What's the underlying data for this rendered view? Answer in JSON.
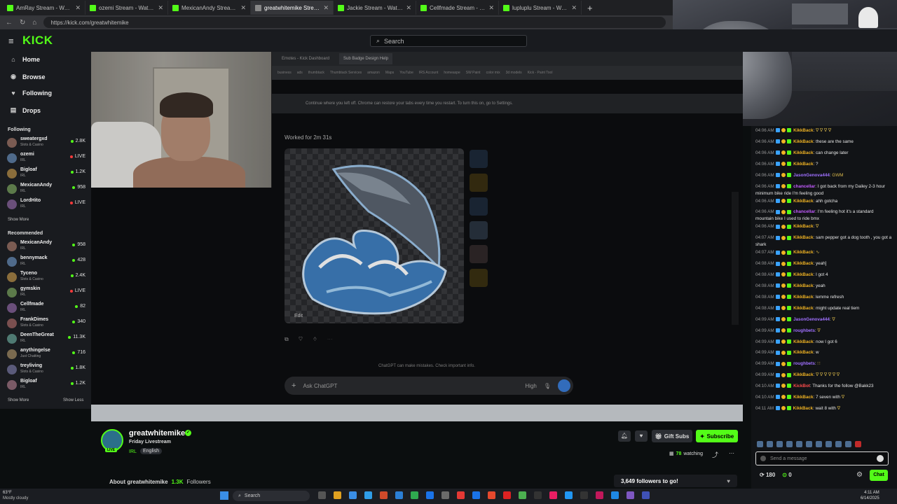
{
  "browser": {
    "tabs": [
      {
        "label": "AmRay Stream - Watch Live o",
        "active": false
      },
      {
        "label": "ozemi Stream - Watch Live on",
        "active": false
      },
      {
        "label": "MexicanAndy Stream - Watch",
        "active": false
      },
      {
        "label": "greatwhitemike Stream - Wat",
        "active": true
      },
      {
        "label": "Jackie Stream - Watch Live on Kick",
        "active": false
      },
      {
        "label": "Cellfmade Stream - Watch Live on",
        "active": false
      },
      {
        "label": "lupluplu Stream - Watch Live on K",
        "active": false
      }
    ],
    "url": "https://kick.com/greatwhitemike"
  },
  "header": {
    "logo": "KICK",
    "search_placeholder": "Search"
  },
  "sidebar": {
    "nav": [
      {
        "label": "Home",
        "icon": "home-icon",
        "glyph": "⌂"
      },
      {
        "label": "Browse",
        "icon": "compass-icon",
        "glyph": "◉"
      },
      {
        "label": "Following",
        "icon": "heart-icon",
        "glyph": "♥"
      },
      {
        "label": "Drops",
        "icon": "drops-icon",
        "glyph": "▤"
      }
    ],
    "following_heading": "Following",
    "following": [
      {
        "name": "sweatergxd",
        "category": "Slots & Casino",
        "viewers": "2.8K"
      },
      {
        "name": "ozemi",
        "category": "IRL",
        "viewers": "LIVE"
      },
      {
        "name": "Bigloaf",
        "category": "IRL",
        "viewers": "1.2K"
      },
      {
        "name": "MexicanAndy",
        "category": "IRL",
        "viewers": "958"
      },
      {
        "name": "LordHito",
        "category": "IRL",
        "viewers": "LIVE"
      }
    ],
    "following_show_more": "Show More",
    "recommended_heading": "Recommended",
    "recommended": [
      {
        "name": "MexicanAndy",
        "category": "IRL",
        "viewers": "958"
      },
      {
        "name": "bennymack",
        "category": "IRL",
        "viewers": "428"
      },
      {
        "name": "Tyceno",
        "category": "Slots & Casino",
        "viewers": "2.4K"
      },
      {
        "name": "gymskin",
        "category": "IRL",
        "viewers": "LIVE"
      },
      {
        "name": "Cellfmade",
        "category": "IRL",
        "viewers": "82"
      },
      {
        "name": "FrankDimes",
        "category": "Slots & Casino",
        "viewers": "340"
      },
      {
        "name": "DeenTheGreat",
        "category": "IRL",
        "viewers": "11.3K"
      },
      {
        "name": "anythingelse",
        "category": "Just Chatting",
        "viewers": "716"
      },
      {
        "name": "treyliving",
        "category": "Slots & Casino",
        "viewers": "1.8K"
      },
      {
        "name": "Bigloaf",
        "category": "IRL",
        "viewers": "1.2K"
      }
    ],
    "rec_show_more": "Show More",
    "rec_show_less": "Show Less"
  },
  "stream_content": {
    "inner_tabs": [
      "Emotes - Kick Dashboard",
      "Sub Badge Design Help"
    ],
    "bookmarks": [
      "business",
      "ads",
      "thumbtack",
      "Thumbtack Services",
      "amazon",
      "Maps",
      "YouTube",
      "IRS Account",
      "homeaspe",
      "SW Paint",
      "color mix",
      "3d models",
      "Kick - Paint Tool"
    ],
    "restore_text": "Continue where you left off. Chrome can restore your tabs every time you restart. To turn this on, go to Settings.",
    "worked_for": "Worked for 2m 31s",
    "edit_label": "Edit",
    "disclaimer": "ChatGPT can make mistakes. Check important info.",
    "ask_placeholder": "Ask ChatGPT",
    "model_mode": "High"
  },
  "channel": {
    "name": "greatwhitemike",
    "live_badge": "LIVE",
    "title": "Friday Livestream",
    "category": "IRL",
    "language": "English",
    "gift_label": "Gift Subs",
    "subscribe_label": "Subscribe",
    "watching_count": "78",
    "watching_label": "watching",
    "about_label": "About greatwhitemike",
    "followers_count": "1.3K",
    "followers_label": "Followers",
    "goal_text": "3,649 followers to go!"
  },
  "chat": {
    "messages": [
      {
        "ts": "04:06 AM",
        "user": "KikkBack",
        "color": "#f0b323",
        "text": "",
        "emotes": "∇ ∇ ∇ ∇"
      },
      {
        "ts": "04:06 AM",
        "user": "KikkBack",
        "color": "#f0b323",
        "text": "these are the same",
        "emotes": ""
      },
      {
        "ts": "04:06 AM",
        "user": "KikkBack",
        "color": "#f0b323",
        "text": "can change later",
        "emotes": ""
      },
      {
        "ts": "04:06 AM",
        "user": "KikkBack",
        "color": "#f0b323",
        "text": "?",
        "emotes": ""
      },
      {
        "ts": "04:06 AM",
        "user": "JasonGenova444",
        "color": "#a070ff",
        "text": "",
        "emotes": "GWM"
      },
      {
        "ts": "04:06 AM",
        "user": "chancellar",
        "color": "#c45cff",
        "text": "I got back from my Dailey 2-3 hour minimum bike ride I'm feeling good",
        "emotes": ""
      },
      {
        "ts": "04:06 AM",
        "user": "KikkBack",
        "color": "#f0b323",
        "text": "ahh gotcha",
        "emotes": ""
      },
      {
        "ts": "04:06 AM",
        "user": "chancellar",
        "color": "#c45cff",
        "text": "I'm feeling hot it's a standard mountain bike I used to ride bmx",
        "emotes": ""
      },
      {
        "ts": "04:06 AM",
        "user": "KikkBack",
        "color": "#f0b323",
        "text": "",
        "emotes": "∇"
      },
      {
        "ts": "04:07 AM",
        "user": "KikkBack",
        "color": "#f0b323",
        "text": "sam pepper got a dog tooth , you got a shark",
        "emotes": ""
      },
      {
        "ts": "04:07 AM",
        "user": "KikkBack",
        "color": "#f0b323",
        "text": "",
        "emotes": "∿"
      },
      {
        "ts": "04:08 AM",
        "user": "KikkBack",
        "color": "#f0b323",
        "text": "yeah]",
        "emotes": ""
      },
      {
        "ts": "04:08 AM",
        "user": "KikkBack",
        "color": "#f0b323",
        "text": "I got 4",
        "emotes": ""
      },
      {
        "ts": "04:08 AM",
        "user": "KikkBack",
        "color": "#f0b323",
        "text": "yeah",
        "emotes": ""
      },
      {
        "ts": "04:08 AM",
        "user": "KikkBack",
        "color": "#f0b323",
        "text": "lemme refresh",
        "emotes": ""
      },
      {
        "ts": "04:08 AM",
        "user": "KikkBack",
        "color": "#f0b323",
        "text": "might update real tiem",
        "emotes": ""
      },
      {
        "ts": "04:09 AM",
        "user": "JasonGenova444",
        "color": "#a070ff",
        "text": "",
        "emotes": "∇"
      },
      {
        "ts": "04:09 AM",
        "user": "roughbets",
        "color": "#a070ff",
        "text": "",
        "emotes": "∇"
      },
      {
        "ts": "04:09 AM",
        "user": "KikkBack",
        "color": "#f0b323",
        "text": "now I got 6",
        "emotes": ""
      },
      {
        "ts": "04:09 AM",
        "user": "KikkBack",
        "color": "#f0b323",
        "text": "w",
        "emotes": ""
      },
      {
        "ts": "04:09 AM",
        "user": "roughbets",
        "color": "#a070ff",
        "text": "",
        "emotes": "∷"
      },
      {
        "ts": "04:09 AM",
        "user": "KikkBack",
        "color": "#f0b323",
        "text": "",
        "emotes": "∇ ∇ ∇ ∇ ∇ ∇"
      },
      {
        "ts": "04:10 AM",
        "user": "KickBot",
        "color": "#ff4d4d",
        "text": "Thanks for the follow @Bakk23",
        "emotes": ""
      },
      {
        "ts": "04:10 AM",
        "user": "KikkBack",
        "color": "#f0b323",
        "text": "7 seven with",
        "emotes": "∇"
      },
      {
        "ts": "04:11 AM",
        "user": "KikkBack",
        "color": "#f0b323",
        "text": "wait 8 with",
        "emotes": "∇"
      }
    ],
    "input_placeholder": "Send a message",
    "points": "180",
    "green_points": "0",
    "send_label": "Chat"
  },
  "taskbar": {
    "temperature": "63°F",
    "weather": "Mostly cloudy",
    "search_label": "Search",
    "time": "4:11 AM",
    "date": "6/14/2025"
  }
}
